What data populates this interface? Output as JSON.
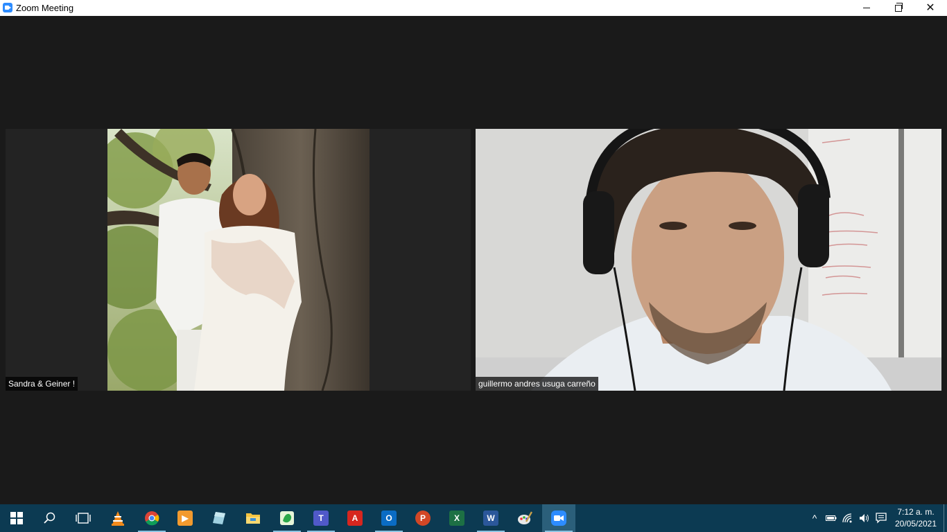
{
  "window": {
    "title": "Zoom Meeting",
    "close_glyph": "✕"
  },
  "participants": [
    {
      "name": "Sandra & Geiner !"
    },
    {
      "name": "guillermo andres usuga carreño"
    }
  ],
  "taskbar": {
    "apps": [
      {
        "name": "start-icon"
      },
      {
        "name": "search-icon"
      },
      {
        "name": "task-view-icon"
      },
      {
        "name": "vlc-icon"
      },
      {
        "name": "chrome-icon"
      },
      {
        "name": "media-player-icon"
      },
      {
        "name": "notes-app-icon"
      },
      {
        "name": "file-explorer-icon"
      },
      {
        "name": "green-app-icon"
      },
      {
        "name": "teams-icon",
        "letter": "T"
      },
      {
        "name": "acrobat-icon",
        "letter": "A"
      },
      {
        "name": "outlook-icon",
        "letter": "O"
      },
      {
        "name": "powerpoint-icon",
        "letter": "P"
      },
      {
        "name": "excel-icon",
        "letter": "X"
      },
      {
        "name": "word-icon",
        "letter": "W"
      },
      {
        "name": "paint-icon"
      },
      {
        "name": "zoom-icon"
      }
    ],
    "tray": {
      "chevron": "^",
      "time": "7:12 a. m.",
      "date": "20/05/2021"
    }
  },
  "colors": {
    "meeting_bg": "#1a1a1a",
    "taskbar_bg": "#0c3a52",
    "zoom_blue": "#2d8cff"
  }
}
